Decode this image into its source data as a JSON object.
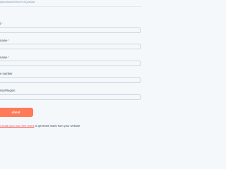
{
  "form": {
    "id_text": "6jfsnaTasbsSHkOVCSQ2a0dw",
    "fields": [
      {
        "label": "t",
        "required": true,
        "value": ""
      },
      {
        "label": "name",
        "required": true,
        "value": ""
      },
      {
        "label": "name",
        "required": true,
        "value": ""
      },
      {
        "label": "e number",
        "required": false,
        "value": ""
      },
      {
        "label": "ntry/Region",
        "required": false,
        "value": ""
      }
    ],
    "required_mark": "*",
    "submit_label": "ubmit"
  },
  "footer": {
    "link_text": "Create your own free forms",
    "trailing_text": " to generate leads from your website."
  },
  "colors": {
    "accent": "#ff7a59",
    "required": "#f2545b",
    "link": "#f2545b",
    "border": "#cbd6e2",
    "background": "#f5f8fa"
  }
}
